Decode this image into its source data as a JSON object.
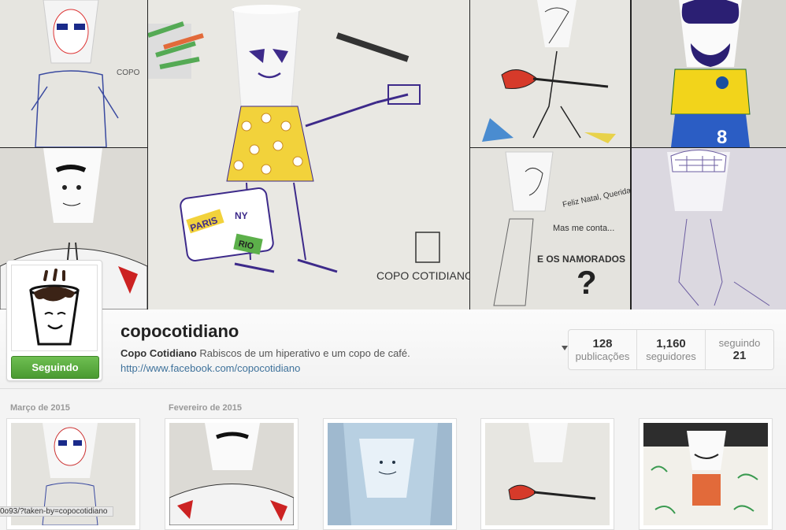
{
  "profile": {
    "username": "copocotidiano",
    "full_name": "Copo Cotidiano",
    "bio": "Rabiscos de um hiperativo e um copo de café.",
    "website": "http://www.facebook.com/copocotidiano",
    "follow_button": "Seguindo"
  },
  "stats": {
    "posts_count": "128",
    "posts_label": "publicações",
    "followers_count": "1,160",
    "followers_label": "seguidores",
    "following_label": "seguindo",
    "following_count": "21"
  },
  "hero_art_text": {
    "big_tile_logo": "COPO COTIDIANO",
    "suitcase_label_1": "PARIS",
    "suitcase_label_2": "NY",
    "suitcase_label_3": "RIO",
    "card_text_1": "Feliz Natal, Querida!",
    "card_text_2": "Mas me conta...",
    "card_text_3": "E OS NAMORADOS",
    "card_mark": "?",
    "shirt_number": "8"
  },
  "timeline": {
    "months": [
      "Março de 2015",
      "Fevereiro de 2015"
    ]
  },
  "status_bar": {
    "url": "0o93/?taken-by=copocotidiano"
  },
  "colors": {
    "follow_green": "#5aa83d",
    "link_blue": "#3f729b"
  }
}
